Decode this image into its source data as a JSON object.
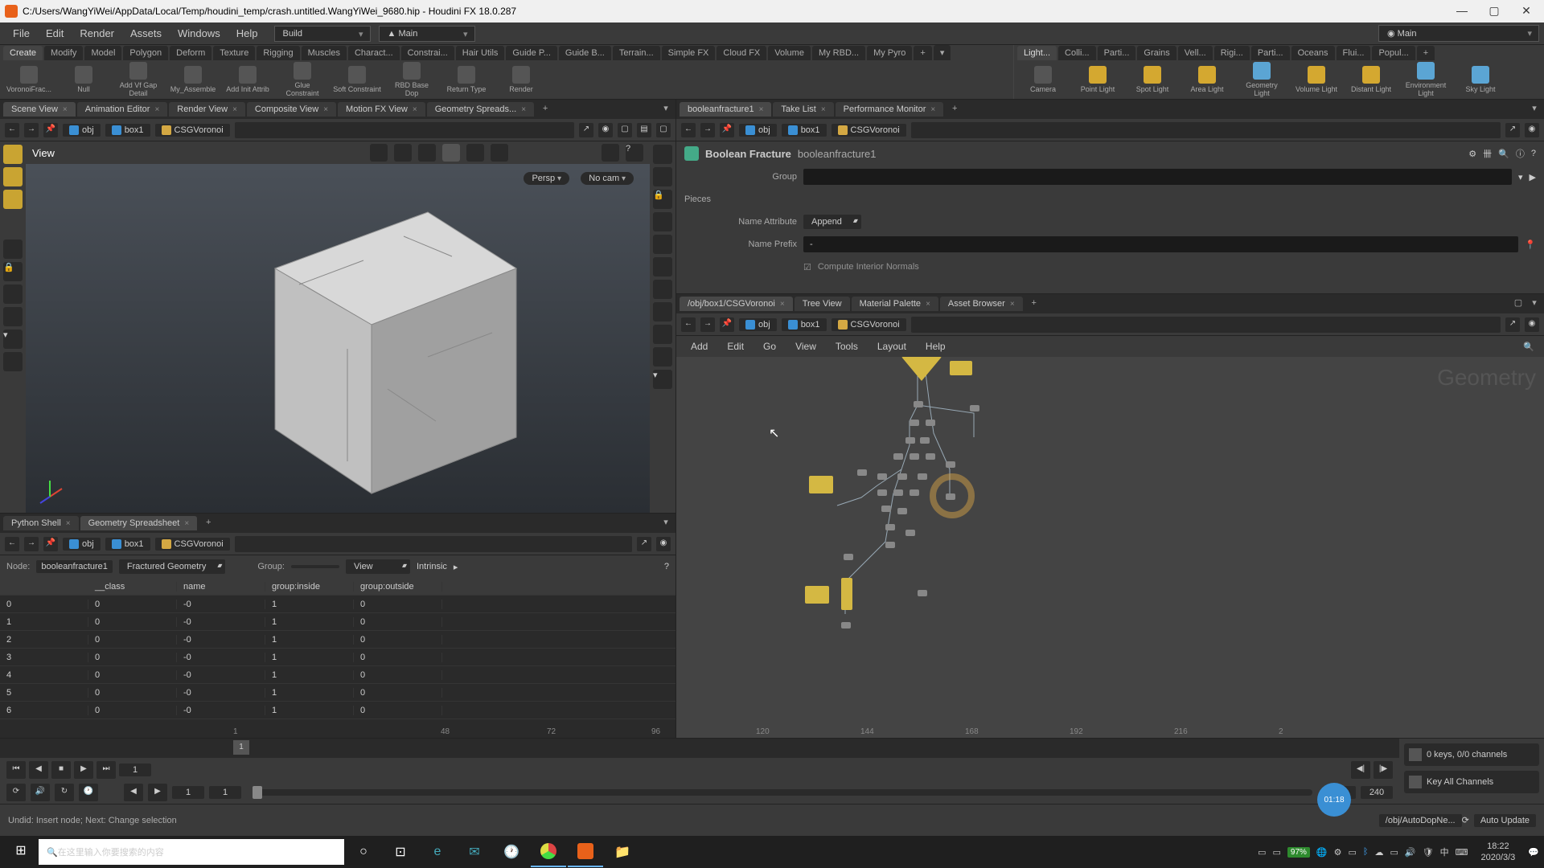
{
  "window": {
    "title": "C:/Users/WangYiWei/AppData/Local/Temp/houdini_temp/crash.untitled.WangYiWei_9680.hip - Houdini FX 18.0.287"
  },
  "menu": {
    "items": [
      "File",
      "Edit",
      "Render",
      "Assets",
      "Windows",
      "Help"
    ],
    "build": "Build",
    "main": "Main",
    "main2": "Main"
  },
  "shelf": {
    "left_tabs": [
      "Create",
      "Modify",
      "Model",
      "Polygon",
      "Deform",
      "Texture",
      "Rigging",
      "Muscles",
      "Charact...",
      "Constrai...",
      "Hair Utils",
      "Guide P...",
      "Guide B...",
      "Terrain...",
      "Simple FX",
      "Cloud FX",
      "Volume",
      "My RBD...",
      "My Pyro"
    ],
    "left_items": [
      {
        "label": "VoronoiFrac..."
      },
      {
        "label": "Null"
      },
      {
        "label": "Add Vf Gap Detail"
      },
      {
        "label": "My_Assemble"
      },
      {
        "label": "Add Init Attrib"
      },
      {
        "label": "Glue Constraint"
      },
      {
        "label": "Soft Constraint"
      },
      {
        "label": "RBD Base Dop"
      },
      {
        "label": "Return Type"
      },
      {
        "label": "Render"
      }
    ],
    "right_tabs": [
      "Light...",
      "Colli...",
      "Parti...",
      "Grains",
      "Vell...",
      "Rigi...",
      "Parti...",
      "Oceans",
      "Flui...",
      "Popul..."
    ],
    "right_items": [
      {
        "label": "Camera"
      },
      {
        "label": "Point Light"
      },
      {
        "label": "Spot Light"
      },
      {
        "label": "Area Light"
      },
      {
        "label": "Geometry Light"
      },
      {
        "label": "Volume Light"
      },
      {
        "label": "Distant Light"
      },
      {
        "label": "Environment Light"
      },
      {
        "label": "Sky Light"
      }
    ]
  },
  "left_pane": {
    "tabs": [
      "Scene View",
      "Animation Editor",
      "Render View",
      "Composite View",
      "Motion FX View",
      "Geometry Spreads..."
    ],
    "path": [
      "obj",
      "box1",
      "CSGVoronoi"
    ],
    "view_label": "View",
    "persp": "Persp",
    "nocam": "No cam"
  },
  "spreadsheet": {
    "tabs": [
      "Python Shell",
      "Geometry Spreadsheet"
    ],
    "path": [
      "obj",
      "box1",
      "CSGVoronoi"
    ],
    "node_label": "Node:",
    "node": "booleanfracture1",
    "group_sel": "Fractured Geometry",
    "group_label": "Group:",
    "view_label": "View",
    "intrinsic": "Intrinsic",
    "cols": [
      "",
      "__class",
      "name",
      "group:inside",
      "group:outside"
    ],
    "rows": [
      [
        "0",
        "0",
        "-0",
        "1",
        "0"
      ],
      [
        "1",
        "0",
        "-0",
        "1",
        "0"
      ],
      [
        "2",
        "0",
        "-0",
        "1",
        "0"
      ],
      [
        "3",
        "0",
        "-0",
        "1",
        "0"
      ],
      [
        "4",
        "0",
        "-0",
        "1",
        "0"
      ],
      [
        "5",
        "0",
        "-0",
        "1",
        "0"
      ],
      [
        "6",
        "0",
        "-0",
        "1",
        "0"
      ]
    ]
  },
  "param": {
    "tabs": [
      "booleanfracture1",
      "Take List",
      "Performance Monitor"
    ],
    "path": [
      "obj",
      "box1",
      "CSGVoronoi"
    ],
    "type": "Boolean Fracture",
    "name": "booleanfracture1",
    "group_label": "Group",
    "pieces_label": "Pieces",
    "name_attr_label": "Name Attribute",
    "name_attr_val": "Append",
    "name_prefix_label": "Name Prefix",
    "name_prefix_val": "-",
    "compute_label": "Compute Interior Normals"
  },
  "network": {
    "tabs": [
      "/obj/box1/CSGVoronoi",
      "Tree View",
      "Material Palette",
      "Asset Browser"
    ],
    "path": [
      "obj",
      "box1",
      "CSGVoronoi"
    ],
    "menu": [
      "Add",
      "Edit",
      "Go",
      "View",
      "Tools",
      "Layout",
      "Help"
    ],
    "watermark": "Geometry",
    "ruler": [
      "120",
      "144",
      "168",
      "192",
      "216",
      "2"
    ]
  },
  "timeline": {
    "frame": "1",
    "start": "1",
    "start2": "1",
    "end": "240",
    "end2": "240",
    "ticks": [
      "1",
      "48",
      "72",
      "96"
    ],
    "keys": "0 keys, 0/0 channels",
    "keyall": "Key All Channels"
  },
  "status": {
    "msg": "Undid: Insert node; Next: Change selection",
    "context": "/obj/AutoDopNe...",
    "update": "Auto Update"
  },
  "taskbar": {
    "search": "在这里输入你要搜索的内容",
    "batt": "97%",
    "time": "18:22",
    "date": "2020/3/3"
  },
  "timer": "01:18"
}
